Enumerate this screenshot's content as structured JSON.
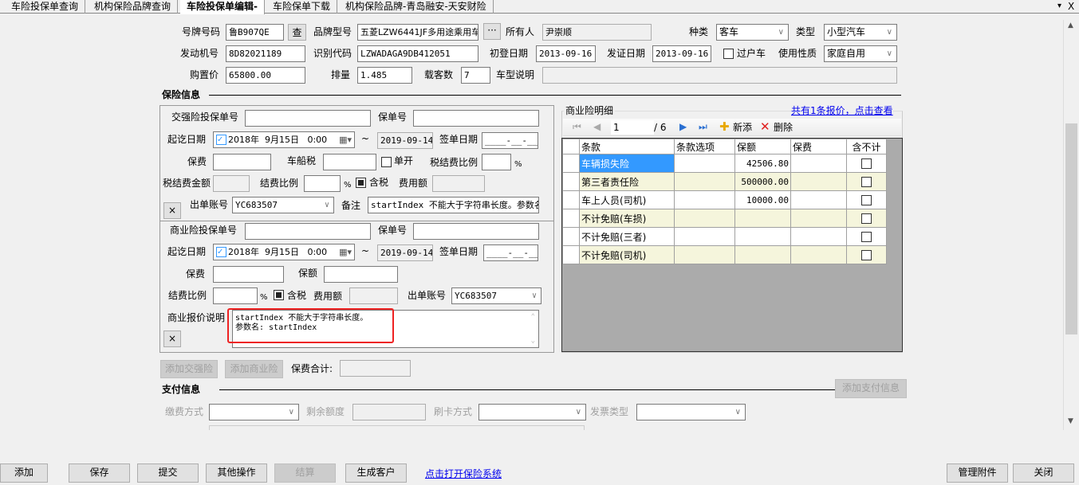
{
  "tabs": [
    "车险投保单查询",
    "机构保险品牌查询",
    "车险投保单编辑-",
    "车险保单下载",
    "机构保险品牌-青岛融安-天安财险"
  ],
  "tab_controls": {
    "dropdown": "▾",
    "close": "X"
  },
  "vehicle": {
    "plate_label": "号牌号码",
    "plate": "鲁B907QE",
    "lookup_btn": "查",
    "brand_label": "品牌型号",
    "brand": "五菱LZW6441JF多用途乘用车",
    "brand_btn": "···",
    "owner_label": "所有人",
    "owner": "尹崇顺",
    "kind_label": "种类",
    "kind": "客车",
    "type_label": "类型",
    "type": "小型汽车",
    "engine_label": "发动机号",
    "engine": "8D82021189",
    "vin_label": "识别代码",
    "vin": "LZWADAGA9DB412051",
    "reg_date_label": "初登日期",
    "reg_date": "2013-09-16",
    "cert_date_label": "发证日期",
    "cert_date": "2013-09-16",
    "transfer_label": "过户车",
    "usage_label": "使用性质",
    "usage": "家庭自用",
    "price_label": "购置价",
    "price": "65800.00",
    "displacement_label": "排量",
    "displacement": "1.485",
    "seats_label": "载客数",
    "seats": "7",
    "model_desc_label": "车型说明",
    "model_desc": ""
  },
  "insurance_title": "保险信息",
  "compulsory": {
    "app_no_label": "交强险投保单号",
    "policy_no_label": "保单号",
    "period_label": "起讫日期",
    "start": "2018年  9月15日   0:00",
    "tilde": "~",
    "end": "2019-09-14",
    "sign_label": "签单日期",
    "sign": "____-__-__",
    "premium_label": "保费",
    "vessel_tax_label": "车船税",
    "separate_label": "单开",
    "tax_fee_ratio_label": "税结费比例",
    "pct": "%",
    "tax_fee_amount_label": "税结费金额",
    "fee_ratio_label": "结费比例",
    "tax_incl_label": "含税",
    "fee_amount_label": "费用额",
    "account_label": "出单账号",
    "account": "YC683507",
    "remark_label": "备注",
    "remark": "startIndex 不能大于字符串长度。参数名: startIndex",
    "remove": "×"
  },
  "commercial": {
    "app_no_label": "商业险投保单号",
    "policy_no_label": "保单号",
    "period_label": "起讫日期",
    "start": "2018年  9月15日   0:00",
    "tilde": "~",
    "end": "2019-09-14",
    "sign_label": "签单日期",
    "sign": "____-__-__",
    "premium_label": "保费",
    "insured_label": "保额",
    "fee_ratio_label": "结费比例",
    "pct": "%",
    "tax_incl_label": "含税",
    "fee_amount_label": "费用额",
    "account_label": "出单账号",
    "account": "YC683507",
    "quote_desc_label": "商业报价说明",
    "quote_desc_line1": "startIndex 不能大于字符串长度。",
    "quote_desc_line2": "参数名: startIndex",
    "remove": "×"
  },
  "add_compulsory": "添加交强险",
  "add_commercial": "添加商业险",
  "premium_total_label": "保费合计:",
  "detail": {
    "title": "商业险明细",
    "link": "共有1条报价，点击查看",
    "page": "1",
    "total": "/ 6",
    "add": "新添",
    "delete": "删除",
    "columns": [
      "条款",
      "条款选项",
      "保额",
      "保费",
      "含不计"
    ],
    "rows": [
      {
        "item": "车辆损失险",
        "option": "",
        "amount": "42506.80",
        "premium": ""
      },
      {
        "item": "第三者责任险",
        "option": "",
        "amount": "500000.00",
        "premium": ""
      },
      {
        "item": "车上人员(司机)",
        "option": "",
        "amount": "10000.00",
        "premium": ""
      },
      {
        "item": "不计免赔(车损)",
        "option": "",
        "amount": "",
        "premium": ""
      },
      {
        "item": "不计免赔(三者)",
        "option": "",
        "amount": "",
        "premium": ""
      },
      {
        "item": "不计免赔(司机)",
        "option": "",
        "amount": "",
        "premium": ""
      }
    ]
  },
  "payment": {
    "title": "支付信息",
    "add": "添加支付信息",
    "method_label": "缴费方式",
    "balance_label": "剩余额度",
    "card_label": "刷卡方式",
    "invoice_label": "发票类型"
  },
  "footer": {
    "add": "添加",
    "save": "保存",
    "submit": "提交",
    "other": "其他操作",
    "settle": "结算",
    "create_customer": "生成客户",
    "open_link": "点击打开保险系统",
    "attachments": "管理附件",
    "close": "关闭"
  },
  "colors": {
    "accent": "#3399ff",
    "error_box": "#ee2222",
    "row_alt": "#f5f5dc",
    "link": "#0000ee"
  }
}
